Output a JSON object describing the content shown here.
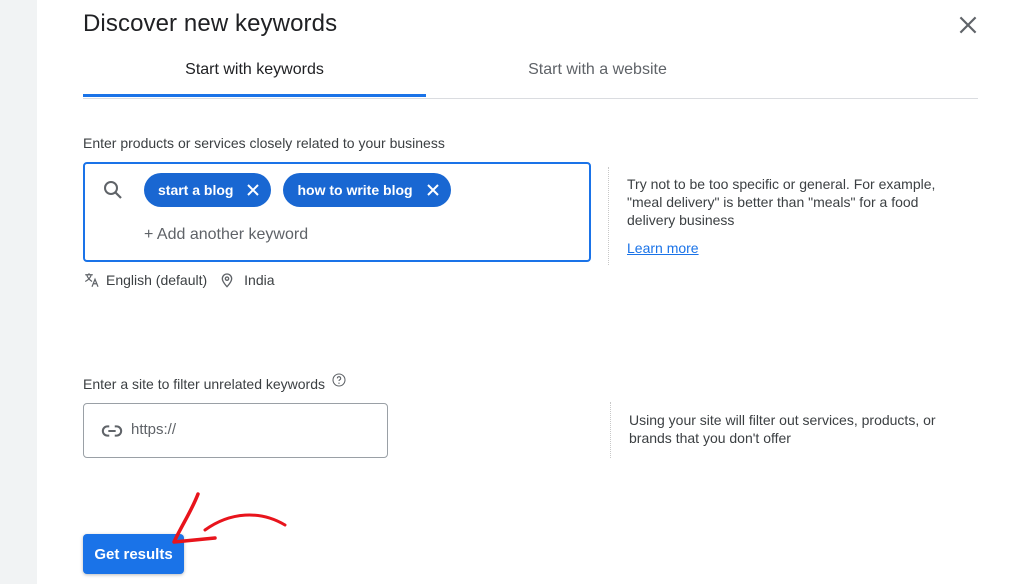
{
  "dialog": {
    "title": "Discover new keywords",
    "close_icon": "close-icon"
  },
  "tabs": [
    {
      "label": "Start with keywords",
      "active": true
    },
    {
      "label": "Start with a website",
      "active": false
    }
  ],
  "keywords_section": {
    "label": "Enter products or services closely related to your business",
    "search_icon": "search-icon",
    "chips": [
      {
        "label": "start a blog"
      },
      {
        "label": "how to write blog"
      }
    ],
    "add_placeholder": "+ Add another keyword",
    "language": "English (default)",
    "location": "India",
    "hint": "Try not to be too specific or general. For example, \"meal delivery\" is better than \"meals\" for a food delivery business",
    "learn_more": "Learn more"
  },
  "site_section": {
    "label": "Enter a site to filter unrelated keywords",
    "placeholder": "https://",
    "hint": "Using your site will filter out services, products, or brands that you don't offer"
  },
  "actions": {
    "get_results": "Get results"
  },
  "annotation": {
    "arrow_color": "#e8141c"
  },
  "colors": {
    "accent": "#1a73e8",
    "chip": "#1967d2"
  }
}
